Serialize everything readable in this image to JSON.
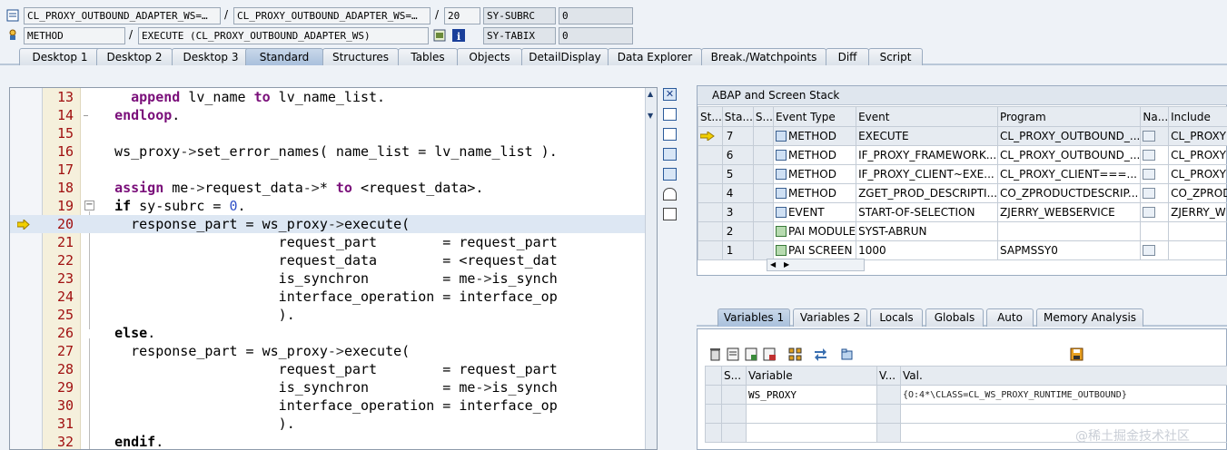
{
  "header": {
    "row1": {
      "class_field": "CL_PROXY_OUTBOUND_ADAPTER_WS=…",
      "include_field": "CL_PROXY_OUTBOUND_ADAPTER_WS=…",
      "line_field": "20",
      "sysvar1_name": "SY-SUBRC",
      "sysvar1_value": "0"
    },
    "row2": {
      "type_field": "METHOD",
      "event_field": "EXECUTE (CL_PROXY_OUTBOUND_ADAPTER_WS)",
      "sysvar2_name": "SY-TABIX",
      "sysvar2_value": "0"
    },
    "separator": "/"
  },
  "tabs": [
    {
      "label": "Desktop 1"
    },
    {
      "label": "Desktop 2"
    },
    {
      "label": "Desktop 3"
    },
    {
      "label": "Standard",
      "active": true
    },
    {
      "label": "Structures"
    },
    {
      "label": "Tables"
    },
    {
      "label": "Objects"
    },
    {
      "label": "DetailDisplay"
    },
    {
      "label": "Data Explorer"
    },
    {
      "label": "Break./Watchpoints"
    },
    {
      "label": "Diff"
    },
    {
      "label": "Script"
    }
  ],
  "code": [
    {
      "n": "13"
    },
    {
      "n": "14"
    },
    {
      "n": "15"
    },
    {
      "n": "16"
    },
    {
      "n": "17"
    },
    {
      "n": "18"
    },
    {
      "n": "19"
    },
    {
      "n": "20",
      "current": true
    },
    {
      "n": "21"
    },
    {
      "n": "22"
    },
    {
      "n": "23"
    },
    {
      "n": "24"
    },
    {
      "n": "25"
    },
    {
      "n": "26"
    },
    {
      "n": "27"
    },
    {
      "n": "28"
    },
    {
      "n": "29"
    },
    {
      "n": "30"
    },
    {
      "n": "31"
    },
    {
      "n": "32"
    }
  ],
  "stack": {
    "title": "ABAP and Screen Stack",
    "columns": [
      "St...",
      "Sta...",
      "S...",
      "Event Type",
      "Event",
      "Program",
      "Na...",
      "Include"
    ],
    "rows": [
      {
        "level": "7",
        "type": "METHOD",
        "event": "EXECUTE",
        "program": "CL_PROXY_OUTBOUND_...",
        "include": "CL_PROXY",
        "current": true
      },
      {
        "level": "6",
        "type": "METHOD",
        "event": "IF_PROXY_FRAMEWORK...",
        "program": "CL_PROXY_OUTBOUND_...",
        "include": "CL_PROXY"
      },
      {
        "level": "5",
        "type": "METHOD",
        "event": "IF_PROXY_CLIENT~EXE...",
        "program": "CL_PROXY_CLIENT===...",
        "include": "CL_PROXY"
      },
      {
        "level": "4",
        "type": "METHOD",
        "event": "ZGET_PROD_DESCRIPTI...",
        "program": "CO_ZPRODUCTDESCRIP...",
        "include": "CO_ZPROD"
      },
      {
        "level": "3",
        "type": "EVENT",
        "event": "START-OF-SELECTION",
        "program": "ZJERRY_WEBSERVICE",
        "include": "ZJERRY_W"
      },
      {
        "level": "2",
        "type": "PAI MODULE",
        "event": "SYST-ABRUN",
        "program": "",
        "include": ""
      },
      {
        "level": "1",
        "type": "PAI SCREEN",
        "event": "1000",
        "program": "SAPMSSY0",
        "include": ""
      }
    ]
  },
  "var_tabs": [
    {
      "label": "Variables 1",
      "active": true
    },
    {
      "label": "Variables 2"
    },
    {
      "label": "Locals"
    },
    {
      "label": "Globals"
    },
    {
      "label": "Auto"
    },
    {
      "label": "Memory Analysis"
    }
  ],
  "variables": {
    "columns": [
      "S...",
      "Variable",
      "V...",
      "Val."
    ],
    "rows": [
      {
        "name": "WS_PROXY",
        "value": "{O:4*\\CLASS=CL_WS_PROXY_RUNTIME_OUTBOUND}"
      }
    ]
  },
  "watermark": "@稀土掘金技术社区",
  "colors": {
    "accent": "#a9c0dc",
    "line_number": "#a01010",
    "keyword": "#7a0f7a",
    "current_line": "#dde7f3"
  }
}
